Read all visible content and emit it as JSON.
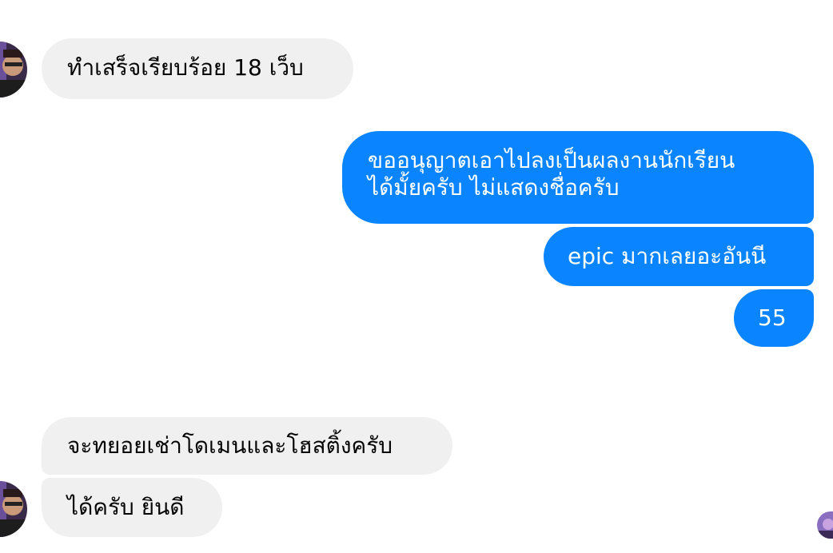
{
  "conversation": {
    "messages": [
      {
        "sender": "other",
        "text": "ทำเสร็จเรียบร้อย 18 เว็บ"
      },
      {
        "sender": "me",
        "lines": [
          "ขออนุญาตเอาไปลงเป็นผลงานนักเรียน",
          "ได้มั้ยครับ ไม่แสดงชื่อครับ"
        ]
      },
      {
        "sender": "me",
        "text": "epic มากเลยอะอันนี"
      },
      {
        "sender": "me",
        "text": "55"
      },
      {
        "sender": "other",
        "text": "จะทยอยเช่าโดเมนและโฮสติ้งครับ"
      },
      {
        "sender": "other",
        "text": "ได้ครับ ยินดี"
      }
    ],
    "avatar_icon": "profile-photo-avatar",
    "seen_icon": "seen-avatar-icon"
  },
  "colors": {
    "outgoing_bubble": "#0a84ff",
    "incoming_bubble": "#f0f0f0",
    "incoming_text": "#050505",
    "outgoing_text": "#ffffff"
  }
}
